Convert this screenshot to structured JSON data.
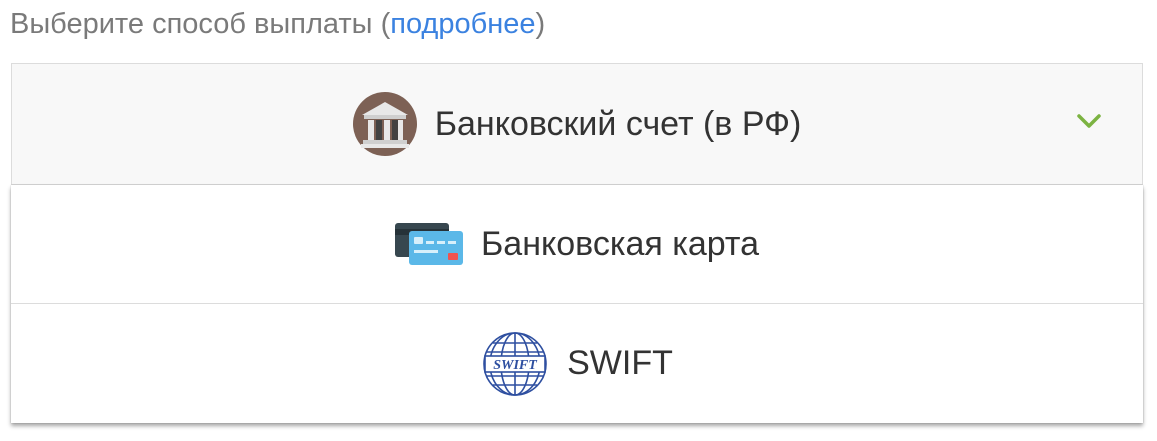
{
  "heading": {
    "prefix": "Выберите способ выплаты (",
    "link": "подробнее",
    "suffix": ")"
  },
  "select": {
    "selected_label": "Банковский счет (в РФ)",
    "selected_icon": "bank-icon",
    "chevron_icon": "chevron-down-icon"
  },
  "options": [
    {
      "label": "Банковская карта",
      "icon": "credit-card-icon"
    },
    {
      "label": "SWIFT",
      "icon": "swift-logo-icon"
    }
  ],
  "colors": {
    "link": "#3b82e0",
    "chevron": "#7cb342",
    "bank_circle": "#7d6155",
    "card_front": "#5bb8e8",
    "card_back": "#37474f"
  },
  "logos": {
    "swift_text": "SWIFT"
  }
}
